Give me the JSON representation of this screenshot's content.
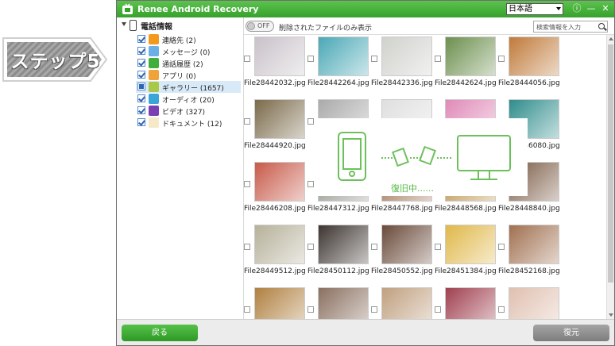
{
  "step": {
    "label": "ステップ5"
  },
  "app": {
    "title": "Renee Android Recovery",
    "language": "日本語",
    "controls": {
      "info": "ⓘ",
      "minimize": "—",
      "close": "✕"
    }
  },
  "sidebar": {
    "root_label": "電話情報",
    "items": [
      {
        "label": "連絡先 (2)",
        "icon": "contacts-icon",
        "color": "#f39a1e",
        "checked": true
      },
      {
        "label": "メッセージ (0)",
        "icon": "message-icon",
        "color": "#6ab0e6",
        "checked": true
      },
      {
        "label": "通話履歴 (2)",
        "icon": "call-log-icon",
        "color": "#3fae3a",
        "checked": true
      },
      {
        "label": "アプリ (0)",
        "icon": "apps-icon",
        "color": "#f0a23b",
        "checked": true
      },
      {
        "label": "ギャラリー (1657)",
        "icon": "gallery-icon",
        "color": "#a8c84a",
        "checked": true,
        "selected": true
      },
      {
        "label": "オーディオ (20)",
        "icon": "audio-icon",
        "color": "#3aa5d8",
        "checked": true
      },
      {
        "label": "ビデオ (327)",
        "icon": "video-icon",
        "color": "#7b3fb5",
        "checked": true
      },
      {
        "label": "ドキュメント (12)",
        "icon": "document-icon",
        "color": "#f4e9c8",
        "checked": true
      }
    ]
  },
  "toolbar": {
    "toggle_label": "OFF",
    "filter_label": "削除されたファイルのみ表示",
    "search_placeholder": "検索情報を入力"
  },
  "files": [
    {
      "name": "File28442032.jpg",
      "color": "#c9c2c9"
    },
    {
      "name": "File28442264.jpg",
      "color": "#4aa8b6"
    },
    {
      "name": "File28442336.jpg",
      "color": "#cfd1cc"
    },
    {
      "name": "File28442624.jpg",
      "color": "#6c8f4e"
    },
    {
      "name": "File28444056.jpg",
      "color": "#c07a3a"
    },
    {
      "name": "File28444920.jpg",
      "color": "#7a6a4a"
    },
    {
      "name": "",
      "color": "#aaaaaa"
    },
    {
      "name": "",
      "color": "#dfdfdf"
    },
    {
      "name": "",
      "color": "#e08ab8"
    },
    {
      "name": "File28446080.jpg",
      "color": "#2f8c8c"
    },
    {
      "name": "File28446208.jpg",
      "color": "#c85a4a"
    },
    {
      "name": "File28447312.jpg",
      "color": "#8a8f84"
    },
    {
      "name": "File28447768.jpg",
      "color": "#9a6b4b"
    },
    {
      "name": "File28448568.jpg",
      "color": "#b88a3e"
    },
    {
      "name": "File28448840.jpg",
      "color": "#7a5a44"
    },
    {
      "name": "File28449512.jpg",
      "color": "#b6b19a"
    },
    {
      "name": "File28450112.jpg",
      "color": "#3c3430"
    },
    {
      "name": "File28450552.jpg",
      "color": "#6a4a3a"
    },
    {
      "name": "File28451384.jpg",
      "color": "#e0b84a"
    },
    {
      "name": "File28452168.jpg",
      "color": "#a07050"
    },
    {
      "name": "",
      "color": "#b08040"
    },
    {
      "name": "",
      "color": "#8a7060"
    },
    {
      "name": "",
      "color": "#c0a080"
    },
    {
      "name": "",
      "color": "#a04050"
    },
    {
      "name": "",
      "color": "#e0c0b0"
    }
  ],
  "overlay": {
    "status": "復旧中......"
  },
  "footer": {
    "back_label": "戻る",
    "recover_label": "復元"
  }
}
